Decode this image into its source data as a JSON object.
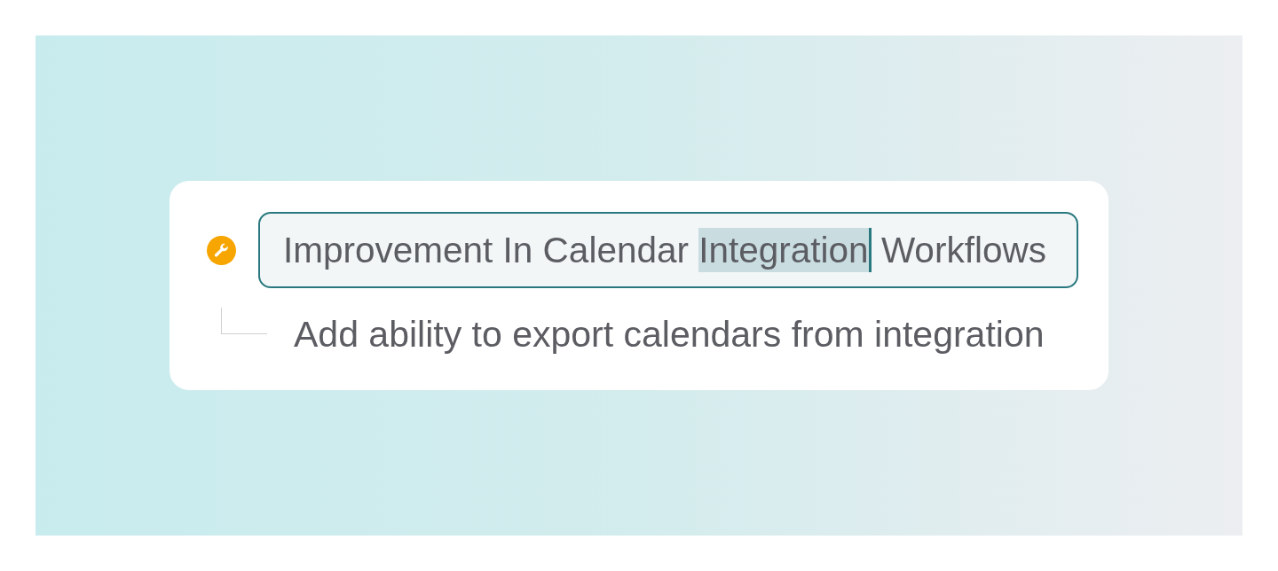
{
  "task": {
    "title": {
      "text_before_selection": "Improvement In Calendar ",
      "selected_text": "Integration",
      "text_after_selection": " Workflows"
    },
    "children": [
      {
        "title": "Add ability to export calendars from integration"
      }
    ]
  }
}
